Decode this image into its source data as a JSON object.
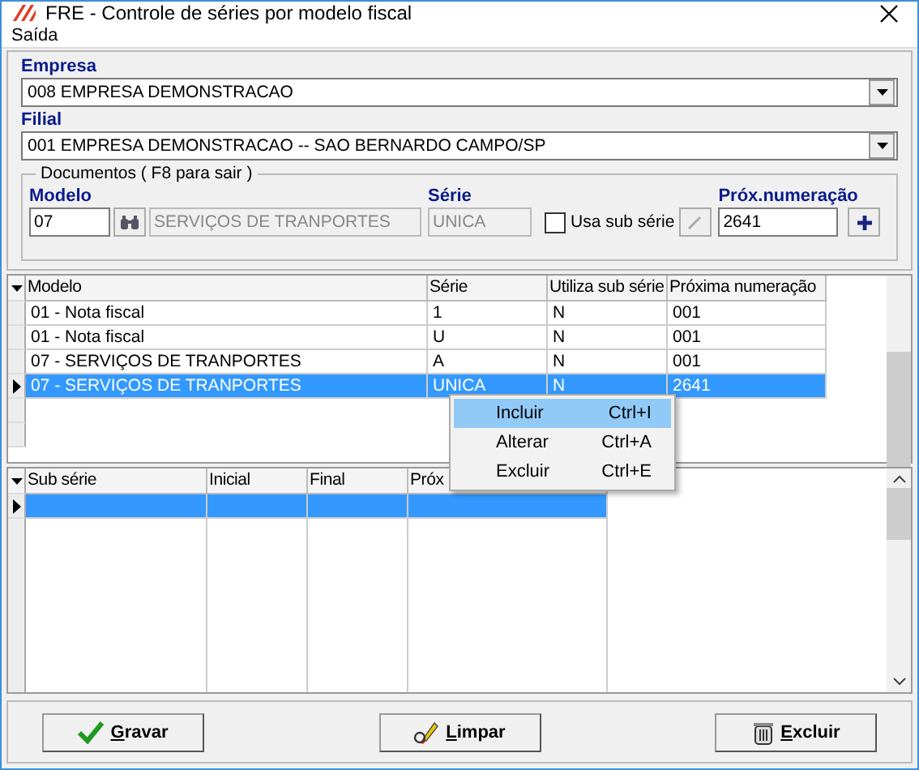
{
  "window": {
    "title": "FRE - Controle de séries por modelo fiscal"
  },
  "menu": [
    "Saída"
  ],
  "empresa": {
    "label": "Empresa",
    "value": "008 EMPRESA DEMONSTRACAO"
  },
  "filial": {
    "label": "Filial",
    "value": "001 EMPRESA DEMONSTRACAO -- SAO BERNARDO CAMPO/SP"
  },
  "documentos": {
    "title": "Documentos ( F8 para sair )",
    "modelo_label": "Modelo",
    "modelo": "07",
    "descricao": "SERVIÇOS DE TRANPORTES",
    "serie_label": "Série",
    "serie": "UNICA",
    "usa_sub_serie": {
      "label": "Usa sub série",
      "checked": false
    },
    "prox_label": "Próx.numeração",
    "prox": "2641"
  },
  "series_table": {
    "columns": [
      "Modelo",
      "Série",
      "Utiliza sub série",
      "Próxima numeração"
    ],
    "rows": [
      {
        "cells": [
          "01  - Nota fiscal",
          "1",
          "N",
          "001"
        ],
        "selected": false
      },
      {
        "cells": [
          "01  - Nota fiscal",
          "U",
          "N",
          "001"
        ],
        "selected": false
      },
      {
        "cells": [
          "07  - SERVIÇOS DE TRANPORTES",
          "A",
          "N",
          "001"
        ],
        "selected": false
      },
      {
        "cells": [
          "07  - SERVIÇOS DE TRANPORTES",
          "UNICA",
          "N",
          "2641"
        ],
        "selected": true
      }
    ]
  },
  "sub_series_table": {
    "columns": [
      "Sub série",
      "Inicial",
      "Final",
      "Próx"
    ],
    "rows": [
      {
        "selected": true
      }
    ]
  },
  "context_menu": {
    "items": [
      {
        "label": "Incluir",
        "shortcut": "Ctrl+I",
        "selected": true
      },
      {
        "label": "Alterar",
        "shortcut": "Ctrl+A",
        "selected": false
      },
      {
        "label": "Excluir",
        "shortcut": "Ctrl+E",
        "selected": false
      }
    ]
  },
  "buttons": [
    {
      "label": "Gravar",
      "kind": "save"
    },
    {
      "label": "Limpar",
      "kind": "clear"
    },
    {
      "label": "Excluir",
      "kind": "delete"
    }
  ]
}
